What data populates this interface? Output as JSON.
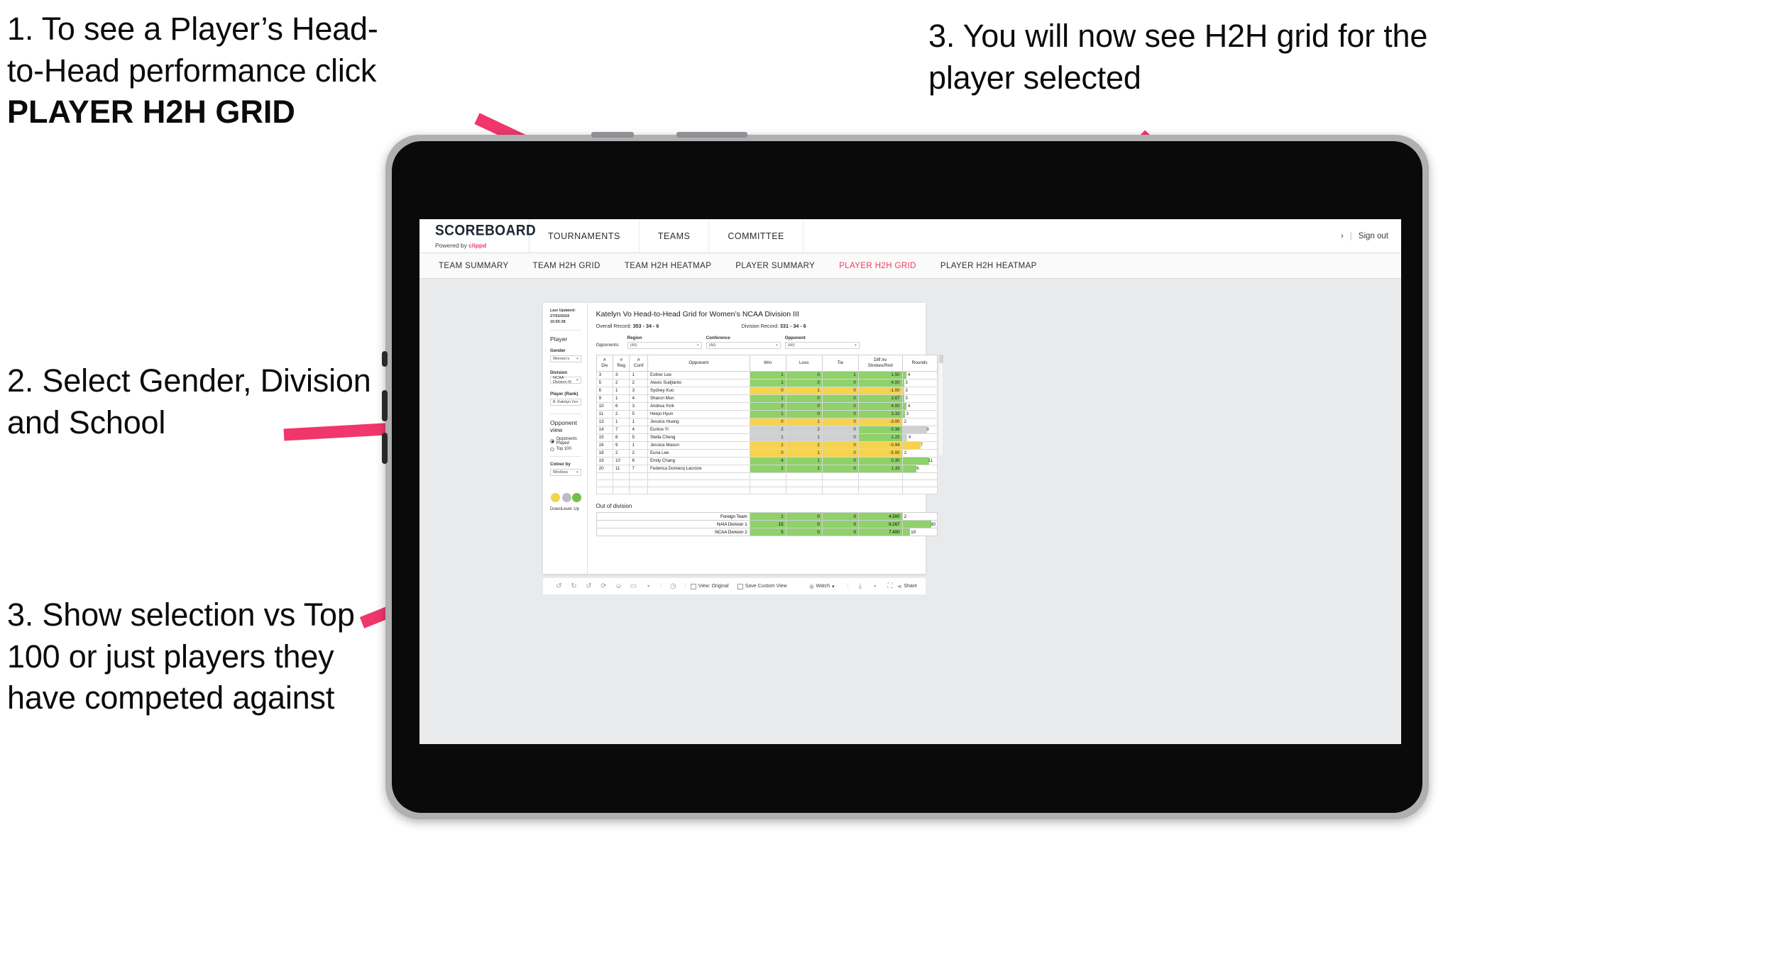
{
  "annotations": {
    "note1_line1": "1. To see a Player’s Head-",
    "note1_line2": "to-Head performance click ",
    "note1_strong": "PLAYER H2H GRID",
    "note2": "2. Select Gender, Division and School",
    "note3": "3. Show selection vs Top 100 or just players they have competed against",
    "note4": "3. You will now see H2H grid for the player selected",
    "arrow_color": "#f0366a"
  },
  "app": {
    "brand": {
      "name": "SCOREBOARD",
      "powered_prefix": "Powered by ",
      "powered_brand": "clippd"
    },
    "topnav": [
      "TOURNAMENTS",
      "TEAMS",
      "COMMITTEE"
    ],
    "topbar_right": {
      "chevron": "›",
      "divider": "|",
      "signout": "Sign out"
    },
    "subnav": [
      {
        "label": "TEAM SUMMARY",
        "active": false
      },
      {
        "label": "TEAM H2H GRID",
        "active": false
      },
      {
        "label": "TEAM H2H HEATMAP",
        "active": false
      },
      {
        "label": "PLAYER SUMMARY",
        "active": false
      },
      {
        "label": "PLAYER H2H GRID",
        "active": true
      },
      {
        "label": "PLAYER H2H HEATMAP",
        "active": false
      }
    ],
    "accent_color": "#ef3a63"
  },
  "filters": {
    "last_updated_line1": "Last Updated: 27/03/2024",
    "last_updated_line2": "16:55:38",
    "player_heading": "Player",
    "gender": {
      "label": "Gender",
      "value": "Women’s"
    },
    "division": {
      "label": "Division",
      "value": "NCAA Division III"
    },
    "player_rank": {
      "label": "Player (Rank)",
      "value": "8. Katelyn Vo"
    },
    "opponent_view": {
      "heading": "Opponent view",
      "options": [
        {
          "label": "Opponents Played",
          "selected": true
        },
        {
          "label": "Top 100",
          "selected": false
        }
      ]
    },
    "colour_by": {
      "label": "Colour by",
      "value": "Win/loss"
    },
    "legend": [
      {
        "label": "Down",
        "color": "#f2d54e"
      },
      {
        "label": "Level",
        "color": "#bcbec0"
      },
      {
        "label": "Up",
        "color": "#72c04a"
      }
    ]
  },
  "report": {
    "title": "Katelyn Vo Head-to-Head Grid for Women’s NCAA Division III",
    "overall_record_label": "Overall Record: ",
    "overall_record_value": "353 -  34 - 6",
    "division_record_label": "Division Record: ",
    "division_record_value": "331 -  34 - 6",
    "opponents_label": "Opponents:",
    "opponent_filters": [
      {
        "label": "Region",
        "value": "(All)"
      },
      {
        "label": "Conference",
        "value": "(All)"
      },
      {
        "label": "Opponent",
        "value": "(All)"
      }
    ],
    "columns": [
      "# Div",
      "# Reg",
      "# Conf",
      "Opponent",
      "Win",
      "Loss",
      "Tie",
      "Diff Av Strokes/Rnd",
      "Rounds"
    ],
    "column_lines": [
      [
        "#",
        "Div"
      ],
      [
        "#",
        "Reg"
      ],
      [
        "#",
        "Conf"
      ],
      [
        "Opponent",
        ""
      ],
      [
        "Win",
        ""
      ],
      [
        "Loss",
        ""
      ],
      [
        "Tie",
        ""
      ],
      [
        "Diff Av",
        "Strokes/Rnd"
      ],
      [
        "Rounds",
        ""
      ]
    ],
    "rows": [
      {
        "div": "3",
        "reg": "3",
        "conf": "1",
        "opponent": "Esther Lee",
        "win": "1",
        "loss": "0",
        "tie": "1",
        "diff": "1.50",
        "rounds": "4",
        "color": "#8fd16a",
        "bar_pct": 12
      },
      {
        "div": "5",
        "reg": "2",
        "conf": "2",
        "opponent": "Alexis Sudjianto",
        "win": "1",
        "loss": "0",
        "tie": "0",
        "diff": "4.00",
        "rounds": "3",
        "color": "#8fd16a",
        "bar_pct": 4
      },
      {
        "div": "6",
        "reg": "1",
        "conf": "3",
        "opponent": "Sydney Kuo",
        "win": "0",
        "loss": "1",
        "tie": "0",
        "diff": "-1.00",
        "rounds": "3",
        "color": "#f5d34f",
        "bar_pct": 4
      },
      {
        "div": "9",
        "reg": "1",
        "conf": "4",
        "opponent": "Sharon Mun",
        "win": "1",
        "loss": "0",
        "tie": "0",
        "diff": "3.67",
        "rounds": "3",
        "color": "#8fd16a",
        "bar_pct": 4
      },
      {
        "div": "10",
        "reg": "6",
        "conf": "3",
        "opponent": "Andrea York",
        "win": "2",
        "loss": "0",
        "tie": "0",
        "diff": "4.00",
        "rounds": "4",
        "color": "#8fd16a",
        "bar_pct": 12
      },
      {
        "div": "11",
        "reg": "2",
        "conf": "5",
        "opponent": "Heejo Hyun",
        "win": "1",
        "loss": "0",
        "tie": "0",
        "diff": "3.33",
        "rounds": "3",
        "color": "#8fd16a",
        "bar_pct": 7
      },
      {
        "div": "13",
        "reg": "1",
        "conf": "1",
        "opponent": "Jessica Huang",
        "win": "0",
        "loss": "1",
        "tie": "0",
        "diff": "-3.00",
        "rounds": "2",
        "color": "#f5d34f",
        "bar_pct": 0
      },
      {
        "div": "14",
        "reg": "7",
        "conf": "4",
        "opponent": "Eunice Yi",
        "win": "2",
        "loss": "2",
        "tie": "0",
        "diff": "0.38",
        "rounds": "9",
        "color": "#cfd0d2",
        "bar_pct": 72,
        "diff_color": "#8fd16a"
      },
      {
        "div": "15",
        "reg": "8",
        "conf": "5",
        "opponent": "Stella Cheng",
        "win": "1",
        "loss": "1",
        "tie": "0",
        "diff": "1.25",
        "rounds": "4",
        "color": "#cfd0d2",
        "bar_pct": 14,
        "diff_color": "#8fd16a"
      },
      {
        "div": "16",
        "reg": "9",
        "conf": "1",
        "opponent": "Jessica Mason",
        "win": "1",
        "loss": "2",
        "tie": "0",
        "diff": "-0.94",
        "rounds": "7",
        "color": "#f5d34f",
        "bar_pct": 52
      },
      {
        "div": "18",
        "reg": "2",
        "conf": "2",
        "opponent": "Euna Lee",
        "win": "0",
        "loss": "1",
        "tie": "0",
        "diff": "-5.00",
        "rounds": "2",
        "color": "#f5d34f",
        "bar_pct": 0
      },
      {
        "div": "19",
        "reg": "10",
        "conf": "6",
        "opponent": "Emily Chang",
        "win": "4",
        "loss": "1",
        "tie": "0",
        "diff": "0.30",
        "rounds": "11",
        "color": "#8fd16a",
        "bar_pct": 78
      },
      {
        "div": "20",
        "reg": "11",
        "conf": "7",
        "opponent": "Federica Domecq Lacroze",
        "win": "2",
        "loss": "1",
        "tie": "0",
        "diff": "1.33",
        "rounds": "6",
        "color": "#8fd16a",
        "bar_pct": 40
      }
    ],
    "out_of_division": {
      "title": "Out of division",
      "rows": [
        {
          "name": "Foreign Team",
          "win": "1",
          "loss": "0",
          "tie": "0",
          "diff": "4.500",
          "rounds": "2",
          "color": "#8fd16a",
          "bar_pct": 0
        },
        {
          "name": "NAIA Division 1",
          "win": "15",
          "loss": "0",
          "tie": "0",
          "diff": "9.267",
          "rounds": "30",
          "color": "#8fd16a",
          "bar_pct": 85
        },
        {
          "name": "NCAA Division 2",
          "win": "5",
          "loss": "0",
          "tie": "0",
          "diff": "7.400",
          "rounds": "10",
          "color": "#8fd16a",
          "bar_pct": 22
        }
      ]
    }
  },
  "toolbar": {
    "icons": [
      "undo-icon",
      "redo-icon",
      "revert-icon",
      "refresh-icon",
      "pause-icon",
      "rectangle-select-icon",
      "caret-icon"
    ],
    "glyphs": [
      "↺",
      "↻",
      "↶",
      "↻",
      "⎍",
      "▭",
      "▾"
    ],
    "history_glyph": "◷",
    "view_original": "View: Original",
    "save_custom_view": "Save Custom View",
    "watch": "Watch",
    "watch_caret": "▾",
    "download_caret": "▾",
    "share": "Share"
  }
}
